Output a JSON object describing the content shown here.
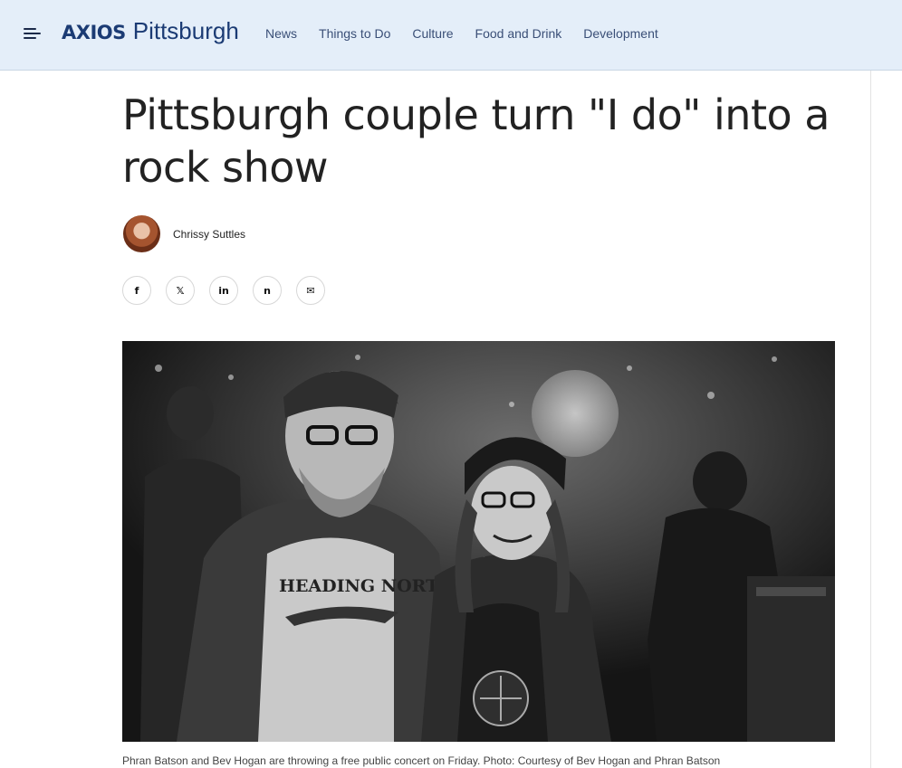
{
  "header": {
    "brand_axios": "AXIOS",
    "brand_city": "Pittsburgh",
    "nav": [
      "News",
      "Things to Do",
      "Culture",
      "Food and Drink",
      "Development"
    ]
  },
  "article": {
    "headline": "Pittsburgh couple turn \"I do\" into a rock show",
    "author": "Chrissy Suttles",
    "share": [
      {
        "name": "facebook-icon",
        "glyph": "f"
      },
      {
        "name": "x-twitter-icon",
        "glyph": "𝕏"
      },
      {
        "name": "linkedin-icon",
        "glyph": "in"
      },
      {
        "name": "nextdoor-icon",
        "glyph": "n"
      },
      {
        "name": "email-icon",
        "glyph": "✉"
      }
    ],
    "photo": {
      "shirt_text": "HEADING NORTH",
      "caption": "Phran Batson and Bev Hogan are throwing a free public concert on Friday. Photo: Courtesy of Bev Hogan and Phran Batson"
    }
  },
  "colors": {
    "header_bg": "#e4eef9",
    "brand": "#1b3b74",
    "nav_text": "#3a4f77"
  }
}
